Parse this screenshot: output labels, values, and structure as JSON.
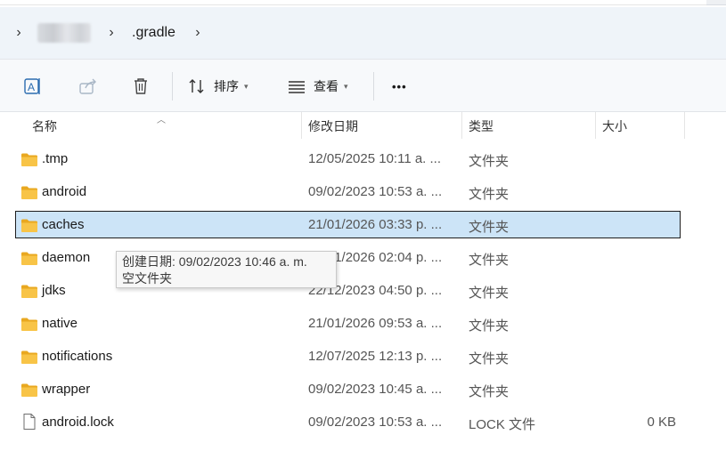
{
  "address": {
    "crumb_hidden": "",
    "current_folder": ".gradle"
  },
  "toolbar": {
    "sort_label": "排序",
    "view_label": "查看",
    "more_label": "•••"
  },
  "columns": {
    "name": "名称",
    "modified": "修改日期",
    "type": "类型",
    "size": "大小"
  },
  "files": [
    {
      "name": ".tmp",
      "date": "12/05/2025 10:11 a. ...",
      "type": "文件夹",
      "size": "",
      "kind": "folder",
      "selected": false
    },
    {
      "name": "android",
      "date": "09/02/2023 10:53 a. ...",
      "type": "文件夹",
      "size": "",
      "kind": "folder",
      "selected": false
    },
    {
      "name": "caches",
      "date": "21/01/2026 03:33 p. ...",
      "type": "文件夹",
      "size": "",
      "kind": "folder",
      "selected": true
    },
    {
      "name": "daemon",
      "date": "21/01/2026 02:04 p. ...",
      "type": "文件夹",
      "size": "",
      "kind": "folder",
      "selected": false
    },
    {
      "name": "jdks",
      "date": "22/12/2023 04:50 p. ...",
      "type": "文件夹",
      "size": "",
      "kind": "folder",
      "selected": false
    },
    {
      "name": "native",
      "date": "21/01/2026 09:53 a. ...",
      "type": "文件夹",
      "size": "",
      "kind": "folder",
      "selected": false
    },
    {
      "name": "notifications",
      "date": "12/07/2025 12:13 p. ...",
      "type": "文件夹",
      "size": "",
      "kind": "folder",
      "selected": false
    },
    {
      "name": "wrapper",
      "date": "09/02/2023 10:45 a. ...",
      "type": "文件夹",
      "size": "",
      "kind": "folder",
      "selected": false
    },
    {
      "name": "android.lock",
      "date": "09/02/2023 10:53 a. ...",
      "type": "LOCK 文件",
      "size": "0 KB",
      "kind": "file",
      "selected": false
    }
  ],
  "tooltip": {
    "line1": "创建日期: 09/02/2023 10:46 a. m.",
    "line2": "空文件夹"
  },
  "colors": {
    "selection": "#cce4f7",
    "folder": "#f8c447",
    "address_bg": "#eff4f9"
  }
}
